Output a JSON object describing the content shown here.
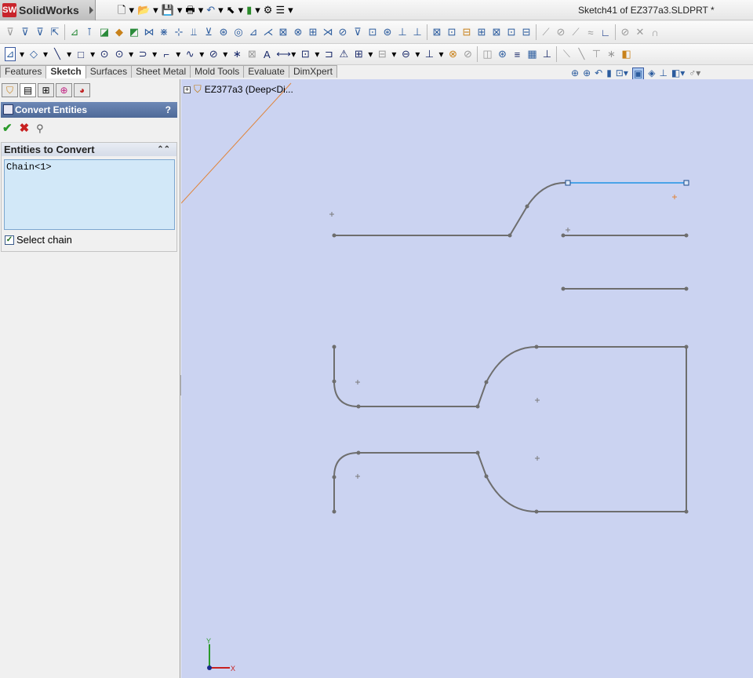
{
  "app": {
    "name": "SolidWorks",
    "logo_letters": "SW"
  },
  "window": {
    "title": "Sketch41 of EZ377a3.SLDPRT *"
  },
  "quick_access": [
    "new-doc-icon",
    "open-icon",
    "save-icon",
    "print-icon",
    "undo-icon",
    "select-icon",
    "rebuild-icon",
    "options-icon",
    "customize-icon"
  ],
  "command_tabs": [
    "Features",
    "Sketch",
    "Surfaces",
    "Sheet Metal",
    "Mold Tools",
    "Evaluate",
    "DimXpert"
  ],
  "active_tab": "Sketch",
  "property_manager": {
    "title": "Convert Entities",
    "help": "?",
    "group_title": "Entities to Convert",
    "selection": "Chain<1>",
    "select_chain_label": "Select chain",
    "select_chain_checked": true
  },
  "feature_tree": {
    "root": "EZ377a3  (Deep<Di..."
  },
  "triad": {
    "x_label": "X",
    "y_label": "Y"
  },
  "colors": {
    "canvas_bg": "#cbd3f1",
    "sketch_line": "#6e6e6e",
    "selected": "#4aa3e8",
    "pm_header": "#5b76a5"
  }
}
